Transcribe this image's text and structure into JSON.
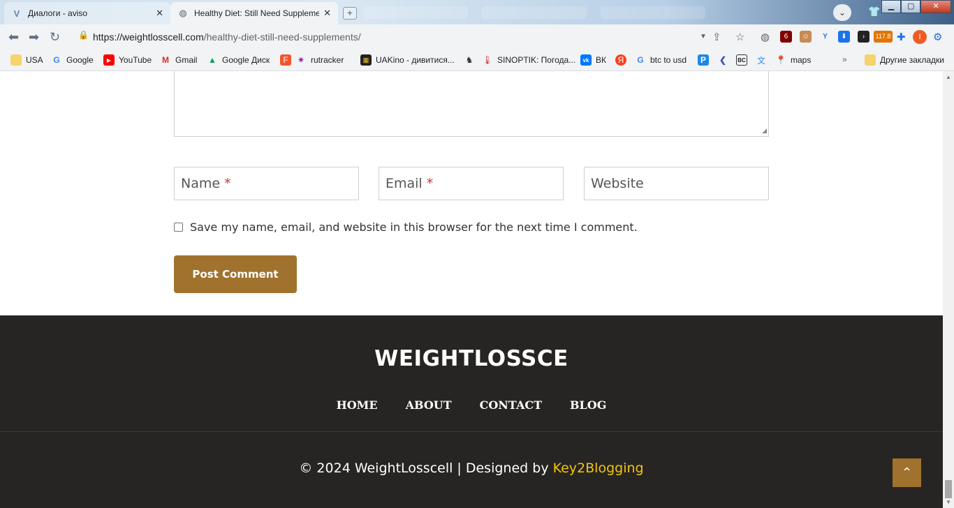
{
  "browser": {
    "tabs": [
      {
        "title": "Диалоги - aviso",
        "active": false
      },
      {
        "title": "Healthy Diet: Still Need Supplemen",
        "active": true
      }
    ],
    "url_host": "https://weightlosscell.com",
    "url_path": "/healthy-diet-still-need-supplements/",
    "extension_badges": {
      "ublock": "6",
      "counter": "117.8"
    },
    "avatar_letter": "I",
    "bookmarks": [
      "USA",
      "Google",
      "YouTube",
      "Gmail",
      "Google Диск",
      "rutracker",
      "UAKino - дивитися...",
      "SINOPTIK: Погода...",
      "ВК",
      "btc to usd",
      "maps"
    ],
    "bookmarks_overflow": "»",
    "other_bookmarks": "Другие закладки"
  },
  "form": {
    "name_placeholder": "Name",
    "email_placeholder": "Email",
    "website_placeholder": "Website",
    "required_mark": "*",
    "save_label": "Save my name, email, and website in this browser for the next time I comment.",
    "post_comment_label": "Post Comment"
  },
  "footer": {
    "logo": "WEIGHTLOSSCE",
    "nav": [
      "HOME",
      "ABOUT",
      "CONTACT",
      "BLOG"
    ],
    "copyright_prefix": "© 2024 WeightLosscell | Designed by ",
    "designer": "Key2Blogging",
    "back_to_top_glyph": "⌃"
  },
  "colors": {
    "accent": "#a0722d",
    "footer_bg": "#272523",
    "link_yellow": "#f2c40f",
    "required_red": "#c0392b"
  }
}
